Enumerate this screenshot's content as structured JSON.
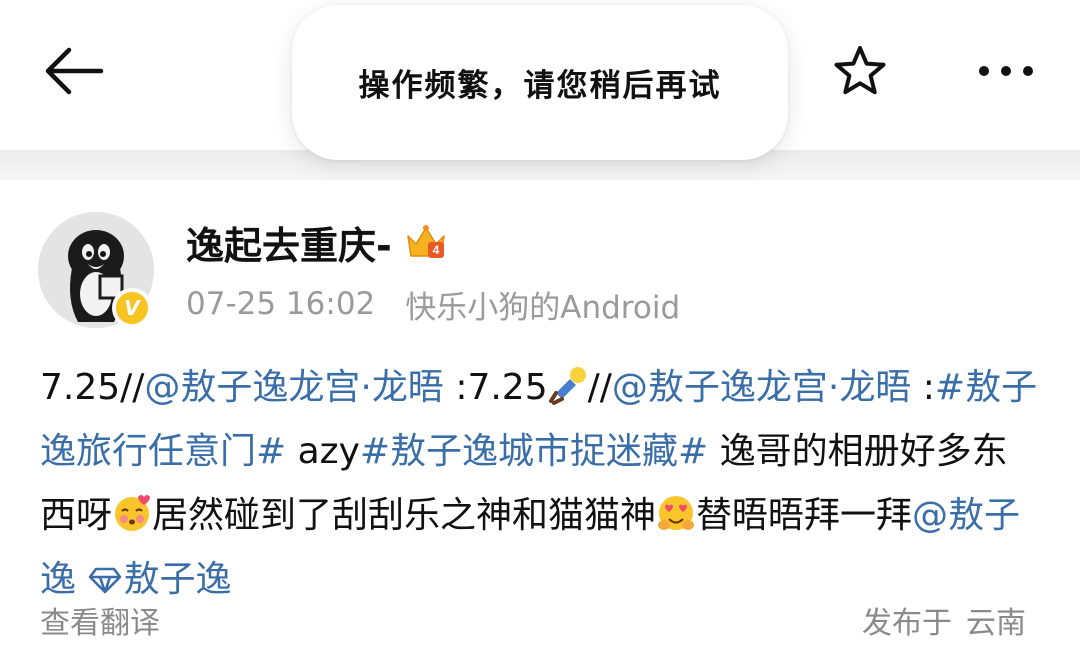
{
  "toast": {
    "message": "操作频繁，请您稍后再试"
  },
  "topbar": {
    "back_icon": "arrow-left-icon",
    "star_icon": "star-outline-icon",
    "more_icon": "more-dots-icon"
  },
  "author": {
    "name": "逸起去重庆-",
    "badge_icon": "crown-level-icon",
    "verified_icon": "verified-v-icon",
    "verified_letter": "V",
    "time": "07-25 16:02",
    "source": "快乐小狗的Android"
  },
  "post": {
    "p1": "7.25//",
    "mention1": "@敖子逸龙宫·龙晤",
    "p2": " :7.25",
    "emoji1": "doll-emoji",
    "p3": "//",
    "mention2": "@敖子逸龙宫·龙晤",
    "p4": " :",
    "topic1": "#敖子逸旅行任意门#",
    "p5": " azy",
    "topic2": "#敖子逸城市捉迷藏#",
    "p6": " 逸哥的相册好多东西呀",
    "emoji2": "blushing-kiss-emoji",
    "p7": "居然碰到了刮刮乐之神和猫猫神",
    "emoji3": "heart-eyes-emoji",
    "p8": "替晤晤拜一拜",
    "mention3": "@敖子逸",
    "superchat_icon": "diamond-icon",
    "superchat": "敖子逸"
  },
  "footer": {
    "translate": "查看翻译",
    "location_prefix": "发布于",
    "location": "云南"
  },
  "colors": {
    "link": "#3a6ea8",
    "meta": "#9a9a9a",
    "verified": "#f7c421"
  }
}
